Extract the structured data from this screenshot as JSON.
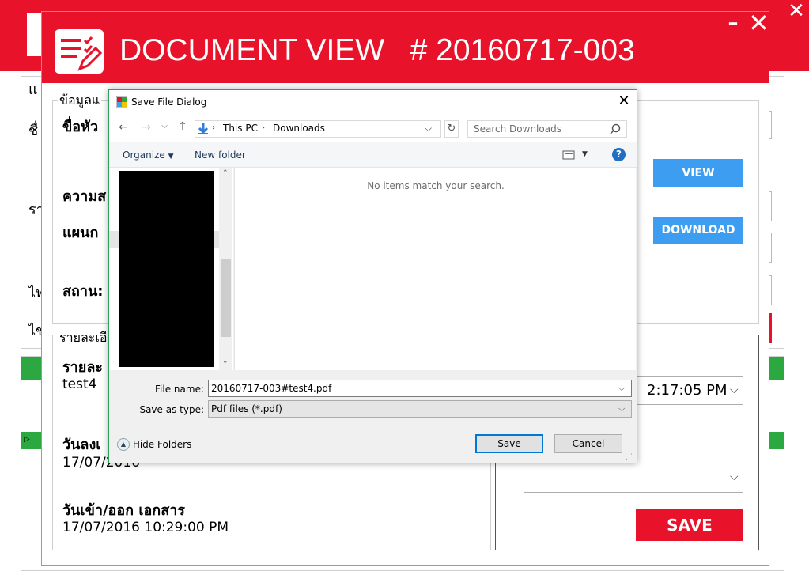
{
  "background_window": {
    "frag_labels": [
      "แ",
      "ชื่",
      "รา",
      "ไท",
      "ไข"
    ]
  },
  "doc_window": {
    "title": "DOCUMENT VIEW   # 20160717-003",
    "minimize_glyph": "–",
    "close_glyph": "✕",
    "group1_legend": "ข้อมูลแ",
    "labels": [
      "ขื่อหัว",
      "ความส",
      "แผนก",
      "สถาน:"
    ],
    "group2_legend": "รายละเอี",
    "detail_label": "รายละ",
    "detail_value": "test4",
    "date_label": "วันลงเ",
    "date_value": "17/07/2016",
    "inout_label": "วันเข้า/ออก เอกสาร",
    "inout_value": "17/07/2016 10:29:00 PM",
    "view_button": "VIEW",
    "download_button": "DOWNLOAD",
    "time_value": "2:17:05 PM",
    "save_button": "SAVE"
  },
  "dialog": {
    "title": "Save File Dialog",
    "address": [
      "This PC",
      "Downloads"
    ],
    "search_placeholder": "Search Downloads",
    "organize": "Organize",
    "new_folder": "New folder",
    "help": "?",
    "empty_message": "No items match your search.",
    "file_name_label": "File name:",
    "file_name_value": "20160717-003#test4.pdf",
    "save_as_label": "Save as type:",
    "save_as_value": "Pdf files (*.pdf)",
    "hide_folders": "Hide Folders",
    "save": "Save",
    "cancel": "Cancel"
  },
  "colors": {
    "accent_red": "#e8132a",
    "button_blue": "#3d9df0",
    "grid_green": "#2ba840",
    "dialog_border": "#2aa35a"
  }
}
